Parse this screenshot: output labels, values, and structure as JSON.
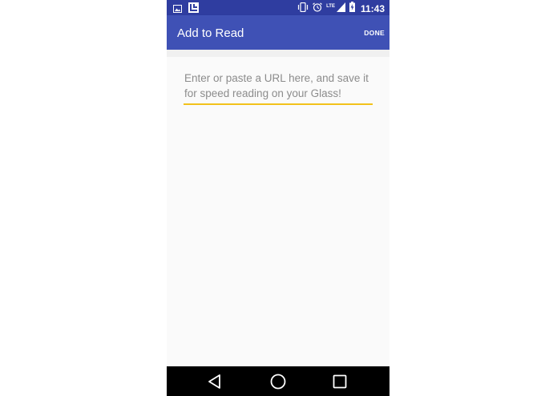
{
  "status_bar": {
    "time": "11:43",
    "network": "LTE",
    "icons": [
      "image-icon",
      "app-logo-icon",
      "vibrate-icon",
      "alarm-icon",
      "signal-icon",
      "battery-charging-icon"
    ]
  },
  "app_bar": {
    "title": "Add to Read",
    "done_label": "DONE"
  },
  "form": {
    "url_input": {
      "value": "",
      "placeholder": "Enter or paste a URL here, and save it for speed reading on your Glass!"
    }
  },
  "colors": {
    "status_bar": "#2f3da0",
    "app_bar": "#3f51b5",
    "accent_underline": "#f2c21b",
    "background": "#fafafa",
    "nav_bar": "#000000"
  },
  "nav_bar": {
    "icons": [
      "back-icon",
      "home-icon",
      "recents-icon"
    ]
  }
}
